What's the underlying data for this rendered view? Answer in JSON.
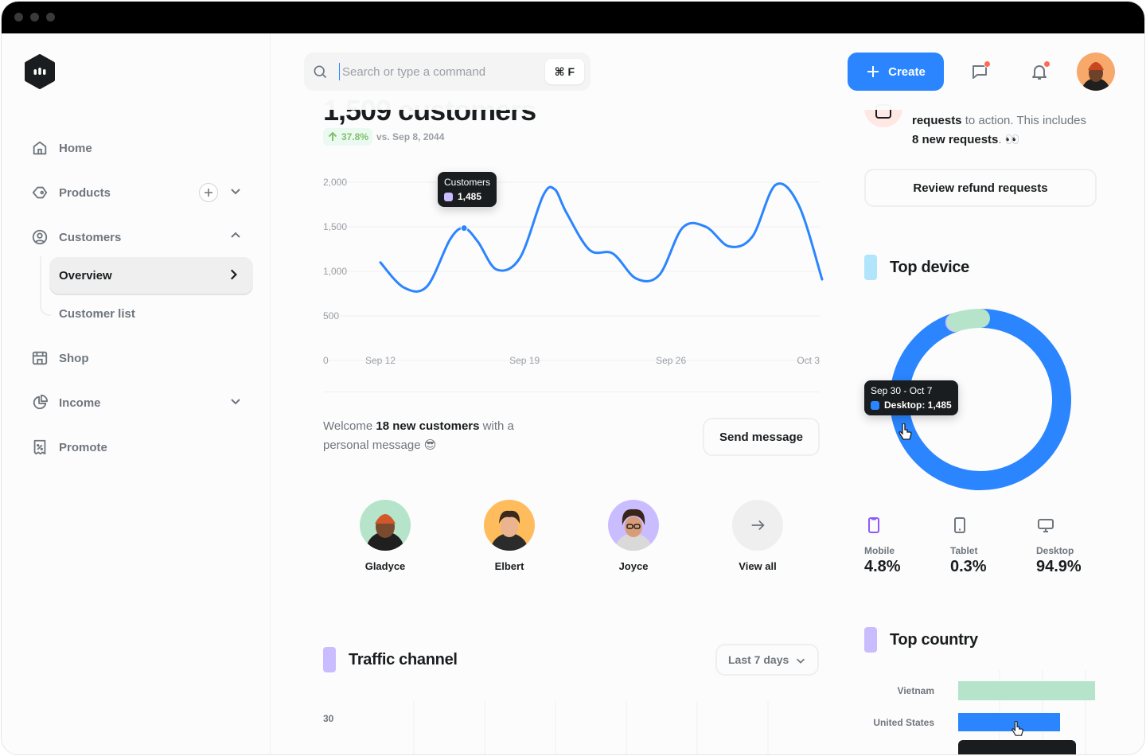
{
  "window": {
    "title": ""
  },
  "sidebar": {
    "items": [
      {
        "label": "Home",
        "icon": "home-icon"
      },
      {
        "label": "Products",
        "icon": "tag-icon"
      },
      {
        "label": "Customers",
        "icon": "user-circle-icon"
      },
      {
        "label": "Shop",
        "icon": "store-icon"
      },
      {
        "label": "Income",
        "icon": "pie-chart-icon"
      },
      {
        "label": "Promote",
        "icon": "receipt-icon"
      }
    ],
    "customers_sub": [
      {
        "label": "Overview",
        "active": true
      },
      {
        "label": "Customer list",
        "active": false
      }
    ]
  },
  "header": {
    "search_placeholder": "Search or type a command",
    "search_shortcut": "⌘ F",
    "create_label": "Create"
  },
  "overview": {
    "title": "1,509 customers",
    "change": "37.8%",
    "compare_text": "vs. Sep 8, 2044",
    "tooltip_title": "Customers",
    "tooltip_value": "1,485",
    "welcome_prefix": "Welcome ",
    "welcome_bold": "18 new customers",
    "welcome_suffix": " with a personal message 😎",
    "send_label": "Send message",
    "customers": [
      {
        "name": "Gladyce"
      },
      {
        "name": "Elbert"
      },
      {
        "name": "Joyce"
      }
    ],
    "view_all_label": "View all"
  },
  "chart_data": {
    "type": "line",
    "title": "",
    "xlabel": "",
    "ylabel": "",
    "ylim": [
      0,
      2000
    ],
    "y_ticks": [
      "0",
      "500",
      "1,000",
      "1,500",
      "2,000"
    ],
    "x_ticks": [
      "Sep 12",
      "Sep 19",
      "Sep 26",
      "Oct 3"
    ],
    "series": [
      {
        "name": "Customers",
        "color": "#2a85ff",
        "points": [
          [
            0.0,
            1100
          ],
          [
            1.0,
            820
          ],
          [
            2.0,
            830
          ],
          [
            3.0,
            1360
          ],
          [
            3.6,
            1485
          ],
          [
            4.2,
            1330
          ],
          [
            5.0,
            1020
          ],
          [
            6.0,
            1150
          ],
          [
            7.0,
            1850
          ],
          [
            7.5,
            1920
          ],
          [
            8.0,
            1660
          ],
          [
            9.0,
            1240
          ],
          [
            10.0,
            1200
          ],
          [
            11.0,
            920
          ],
          [
            12.0,
            960
          ],
          [
            13.0,
            1490
          ],
          [
            14.0,
            1500
          ],
          [
            15.0,
            1280
          ],
          [
            16.0,
            1390
          ],
          [
            17.0,
            1970
          ],
          [
            18.0,
            1740
          ],
          [
            19.0,
            910
          ]
        ]
      }
    ]
  },
  "traffic": {
    "title": "Traffic channel",
    "range_label": "Last 7 days",
    "y_first_tick": "30"
  },
  "refund": {
    "line1_bold": "requests",
    "line1_rest": " to action. This includes",
    "line2_bold": "8 new requests",
    "line2_rest": ". 👀",
    "button_label": "Review refund requests"
  },
  "top_device": {
    "title": "Top device",
    "tooltip_title": "Sep 30 - Oct 7",
    "tooltip_value": "Desktop: 1,485",
    "devices": [
      {
        "label": "Mobile",
        "value": "4.8%",
        "share": 4.8,
        "color": "#b5e4ca"
      },
      {
        "label": "Tablet",
        "value": "0.3%",
        "share": 0.3,
        "color": "#cabdff"
      },
      {
        "label": "Desktop",
        "value": "94.9%",
        "share": 94.9,
        "color": "#2a85ff"
      }
    ]
  },
  "top_country": {
    "title": "Top country",
    "countries": [
      {
        "label": "Vietnam",
        "color": "#b5e4ca"
      },
      {
        "label": "United States",
        "color": "#2a85ff"
      }
    ]
  },
  "colors": {
    "accent": "#2a85ff",
    "green": "#83bf6e",
    "purple": "#cabdff",
    "mint": "#b5e4ca",
    "sky": "#b1e5fc",
    "badge": "#ff6a55"
  }
}
